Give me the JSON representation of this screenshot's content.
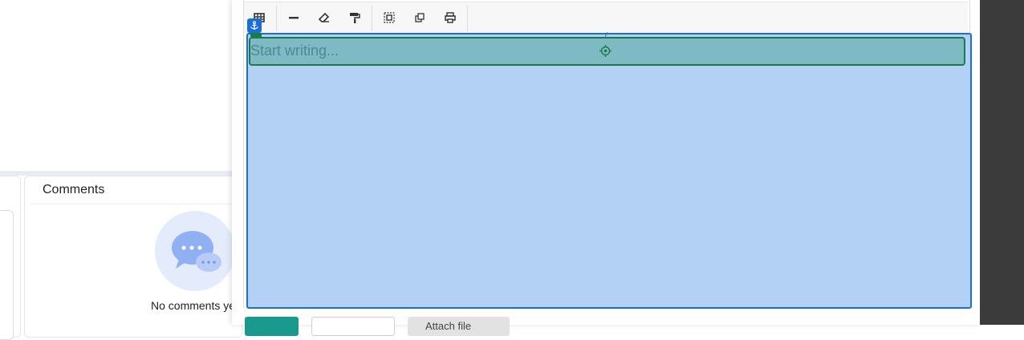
{
  "comments": {
    "title": "Comments",
    "empty_text": "No comments ye"
  },
  "editor": {
    "placeholder": "Start writing...",
    "toolbar": [
      {
        "name": "table-icon"
      },
      {
        "name": "horizontal-rule-icon"
      },
      {
        "name": "eraser-icon"
      },
      {
        "name": "format-painter-icon"
      },
      {
        "name": "select-all-icon"
      },
      {
        "name": "duplicate-icon"
      },
      {
        "name": "print-icon"
      }
    ]
  },
  "footer": {
    "attach_label": "Attach file"
  },
  "colors": {
    "selection": "#b3d1f5",
    "selection_border": "#1a6fd6",
    "block": "#7ebac3",
    "block_border": "#1a7a4a",
    "primary_button": "#1a9a8e",
    "right_panel": "#3b3b3b"
  }
}
